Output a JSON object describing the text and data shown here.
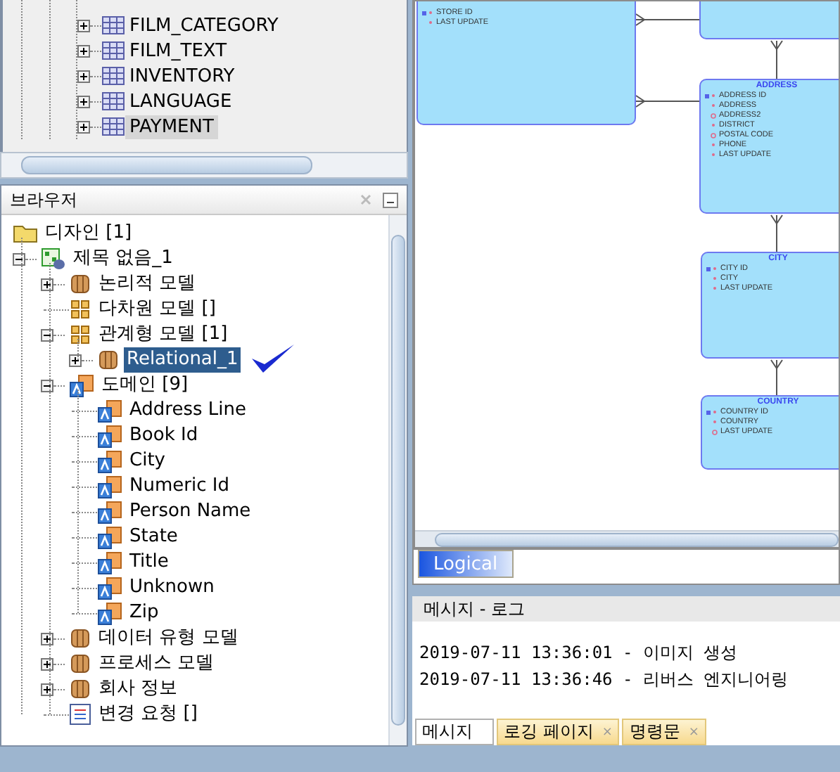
{
  "table_list": {
    "items": [
      {
        "label": "FILM_CATEGORY",
        "selected": false
      },
      {
        "label": "FILM_TEXT",
        "selected": false
      },
      {
        "label": "INVENTORY",
        "selected": false
      },
      {
        "label": "LANGUAGE",
        "selected": false
      },
      {
        "label": "PAYMENT",
        "selected": true
      }
    ]
  },
  "browser": {
    "title": "브라우저",
    "tree": [
      {
        "label": "디자인 [1]",
        "kind": "folder",
        "selected": false,
        "children": [
          {
            "label": "제목 없음_1",
            "kind": "design",
            "expanded": true,
            "selected": false,
            "children": [
              {
                "label": "논리적 모델",
                "kind": "model",
                "expanded": false,
                "selected": false
              },
              {
                "label": "다차원 모델 []",
                "kind": "grid",
                "selected": false
              },
              {
                "label": "관계형 모델 [1]",
                "kind": "grid",
                "expanded": true,
                "selected": false,
                "children": [
                  {
                    "label": "Relational_1",
                    "kind": "model",
                    "expanded": false,
                    "selected": true
                  }
                ]
              },
              {
                "label": "도메인 [9]",
                "kind": "domain",
                "expanded": true,
                "selected": false,
                "children": [
                  {
                    "label": "Address Line",
                    "kind": "domain",
                    "selected": false
                  },
                  {
                    "label": "Book Id",
                    "kind": "domain",
                    "selected": false
                  },
                  {
                    "label": "City",
                    "kind": "domain",
                    "selected": false
                  },
                  {
                    "label": "Numeric Id",
                    "kind": "domain",
                    "selected": false
                  },
                  {
                    "label": "Person Name",
                    "kind": "domain",
                    "selected": false
                  },
                  {
                    "label": "State",
                    "kind": "domain",
                    "selected": false
                  },
                  {
                    "label": "Title",
                    "kind": "domain",
                    "selected": false
                  },
                  {
                    "label": "Unknown",
                    "kind": "domain",
                    "selected": false
                  },
                  {
                    "label": "Zip",
                    "kind": "domain",
                    "selected": false
                  }
                ]
              },
              {
                "label": "데이터 유형 모델",
                "kind": "model",
                "expanded": false,
                "selected": false
              },
              {
                "label": "프로세스 모델",
                "kind": "model",
                "expanded": false,
                "selected": false
              },
              {
                "label": "회사 정보",
                "kind": "model",
                "expanded": false,
                "selected": false
              },
              {
                "label": "변경 요청 []",
                "kind": "list",
                "selected": false
              }
            ]
          }
        ]
      }
    ]
  },
  "diagram": {
    "entities": [
      {
        "attributes": [
          {
            "name": "STORE ID",
            "kind": "pk"
          },
          {
            "name": "LAST UPDATE",
            "kind": "required"
          }
        ]
      },
      {
        "name": "ADDRESS",
        "attributes": [
          {
            "name": "ADDRESS ID",
            "kind": "pk"
          },
          {
            "name": "ADDRESS",
            "kind": "required"
          },
          {
            "name": "ADDRESS2",
            "kind": "optional"
          },
          {
            "name": "DISTRICT",
            "kind": "required"
          },
          {
            "name": "POSTAL CODE",
            "kind": "optional"
          },
          {
            "name": "PHONE",
            "kind": "required"
          },
          {
            "name": "LAST UPDATE",
            "kind": "required"
          }
        ]
      },
      {
        "name": "CITY",
        "attributes": [
          {
            "name": "CITY ID",
            "kind": "pk"
          },
          {
            "name": "CITY",
            "kind": "required"
          },
          {
            "name": "LAST UPDATE",
            "kind": "required"
          }
        ]
      },
      {
        "name": "COUNTRY",
        "attributes": [
          {
            "name": "COUNTRY ID",
            "kind": "pk"
          },
          {
            "name": "COUNTRY",
            "kind": "required"
          },
          {
            "name": "LAST UPDATE",
            "kind": "optional"
          }
        ]
      }
    ],
    "tabs": [
      {
        "label": "Logical",
        "selected": true
      }
    ]
  },
  "log": {
    "title": "메시지 - 로그",
    "lines": [
      "2019-07-11 13:36:01 - 이미지 생성",
      "2019-07-11 13:36:46 - 리버스 엔지니어링"
    ],
    "tabs": [
      {
        "label": "메시지",
        "selected": true
      },
      {
        "label": "로깅 페이지",
        "selected": false,
        "close": "×"
      },
      {
        "label": "명령문",
        "selected": false,
        "close": "×"
      }
    ]
  }
}
